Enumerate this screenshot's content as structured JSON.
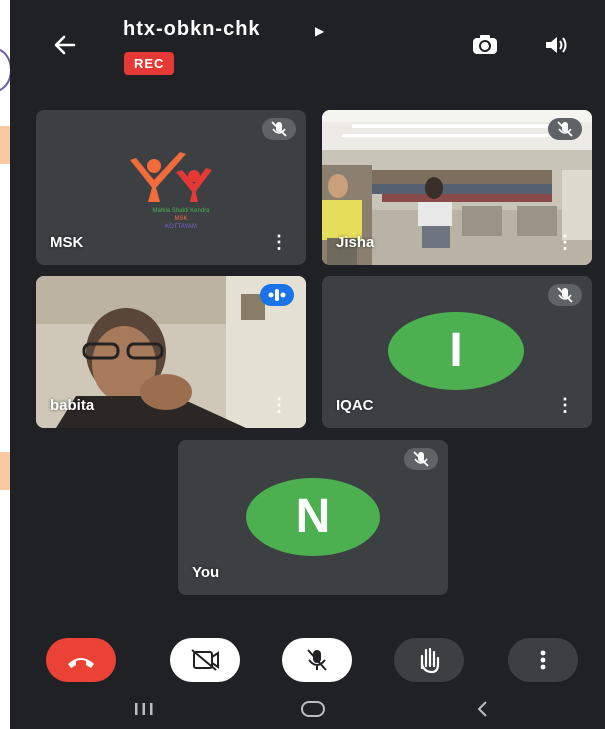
{
  "call": {
    "meeting_code": "htx-obkn-chk",
    "recording_badge": "REC"
  },
  "participants": [
    {
      "name": "MSK",
      "muted": true,
      "logo_text": [
        "Mahila Shakti Kendra",
        "MSK",
        "KOTTAYAM"
      ]
    },
    {
      "name": "Jisha",
      "muted": true
    },
    {
      "name": "babita",
      "speaking": true
    },
    {
      "name": "IQAC",
      "muted": true,
      "avatar_letter": "I",
      "avatar_color": "#4caf50"
    },
    {
      "name": "You",
      "muted": true,
      "avatar_letter": "N",
      "avatar_color": "#4caf50"
    }
  ],
  "controls": [
    "end-call",
    "camera-off",
    "mic-off",
    "raise-hand",
    "more-options"
  ],
  "navigation": [
    "recent-apps",
    "home",
    "back"
  ],
  "colors": {
    "background": "#202124",
    "tile": "#3c4043",
    "end_call": "#ea4335",
    "rec": "#e53935",
    "speaking": "#1a73e8"
  }
}
